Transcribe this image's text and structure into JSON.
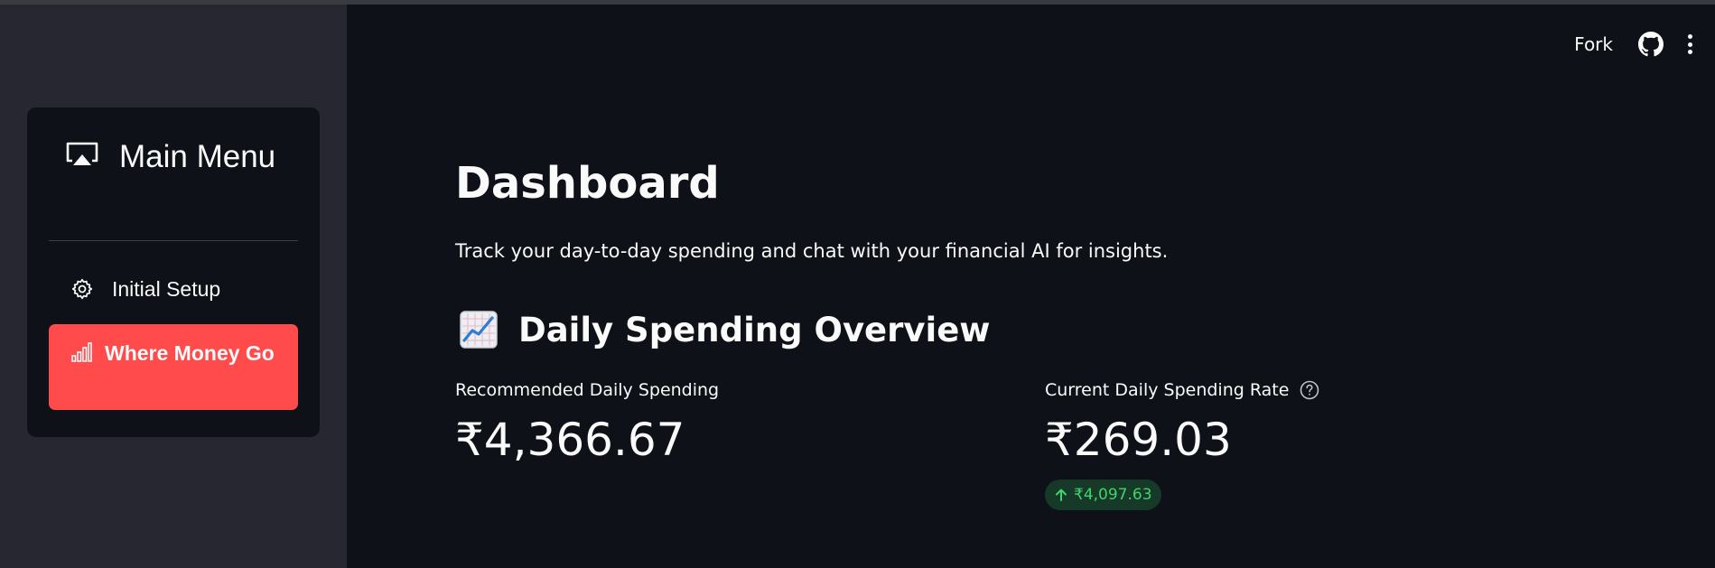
{
  "colors": {
    "accent": "#ff4b4b",
    "sidebar_bg": "#262730",
    "main_bg": "#0e1117",
    "delta_text": "#3dd56d",
    "delta_bg": "#173928"
  },
  "header": {
    "fork_label": "Fork",
    "github_icon": "github-icon",
    "menu_icon": "kebab-menu-icon"
  },
  "sidebar": {
    "menu_icon": "cast-icon",
    "menu_title": "Main Menu",
    "items": [
      {
        "icon": "gear-icon",
        "label": "Initial Setup",
        "active": false
      },
      {
        "icon": "bar-chart-icon",
        "label": "Where Money Go",
        "active": true
      }
    ]
  },
  "main": {
    "title": "Dashboard",
    "caption": "Track your day-to-day spending and chat with your financial AI for insights.",
    "section_icon": "chart-increasing-icon",
    "section_title": "Daily Spending Overview",
    "metrics": [
      {
        "label": "Recommended Daily Spending",
        "value": "₹4,366.67"
      },
      {
        "label": "Current Daily Spending Rate",
        "value": "₹269.03",
        "help_icon": "question-circle-icon",
        "delta": "₹4,097.63",
        "delta_direction": "up"
      }
    ]
  }
}
